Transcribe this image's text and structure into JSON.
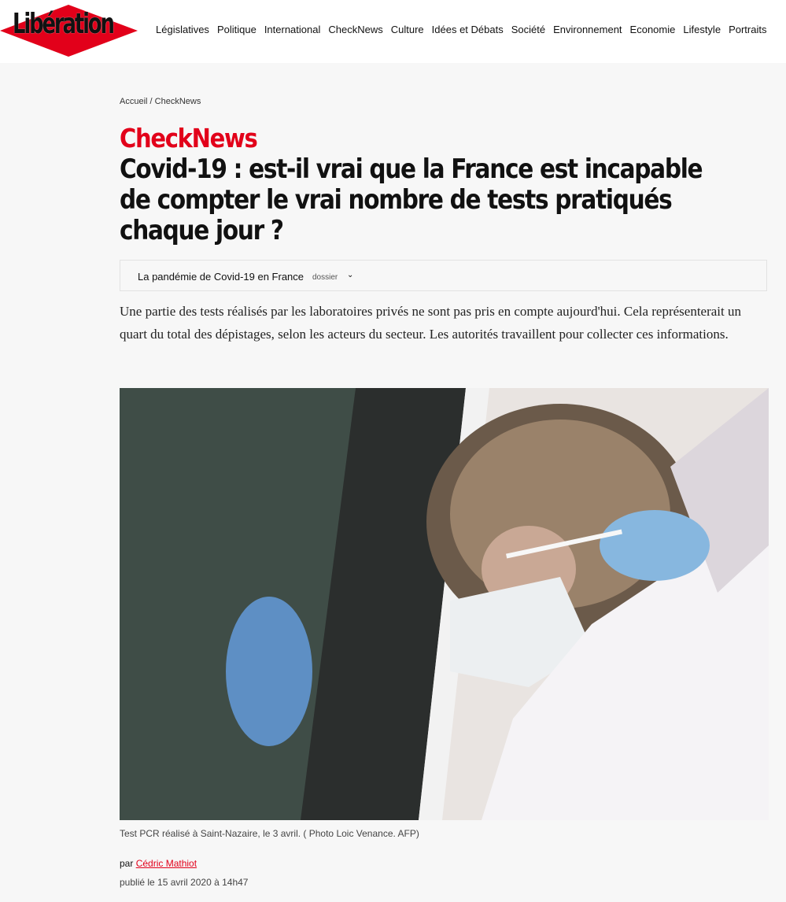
{
  "header": {
    "logo_text": "Libération",
    "nav": [
      "Législatives",
      "Politique",
      "International",
      "CheckNews",
      "Culture",
      "Idées et Débats",
      "Société",
      "Environnement",
      "Economie",
      "Lifestyle",
      "Portraits"
    ]
  },
  "breadcrumb": {
    "home": "Accueil",
    "separator": " / ",
    "section": "CheckNews"
  },
  "article": {
    "kicker": "CheckNews",
    "title": "Covid-19 : est-il vrai que la France est incapable de compter le vrai nombre de tests pratiqués chaque jour ?",
    "dossier": {
      "title": "La pandémie de Covid-19 en France",
      "tag": "dossier",
      "chevron": "chevron-down-icon"
    },
    "lede": "Une partie des tests réalisés par les laboratoires privés ne sont pas pris en compte aujourd'hui. Cela représenterait un quart du total des dépistages, selon les acteurs du secteur. Les autorités travaillent pour collecter ces informations.",
    "caption": "Test PCR réalisé à Saint-Nazaire, le 3 avril. ( Photo Loic Venance. AFP)",
    "byline_prefix": "par",
    "author": "Cédric Mathiot",
    "published": "publié le 15 avril 2020 à 14h47"
  },
  "colors": {
    "accent": "#e2001a",
    "background": "#f7f7f7",
    "text": "#111111"
  }
}
